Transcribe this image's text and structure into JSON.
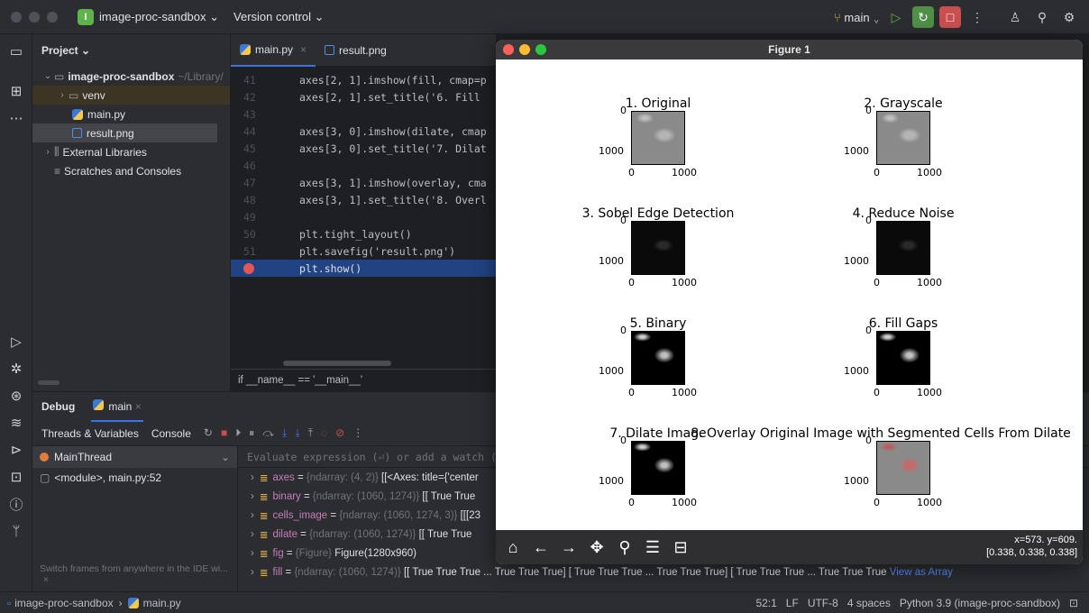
{
  "titlebar": {
    "project_letter": "I",
    "project_name": "image-proc-sandbox",
    "version_control": "Version control",
    "branch": "main"
  },
  "project_panel": {
    "title": "Project",
    "root_name": "image-proc-sandbox",
    "root_path": "~/Library/",
    "items": [
      {
        "label": "venv"
      },
      {
        "label": "main.py"
      },
      {
        "label": "result.png"
      },
      {
        "label": "External Libraries"
      },
      {
        "label": "Scratches and Consoles"
      }
    ]
  },
  "editor": {
    "tabs": [
      {
        "label": "main.py"
      },
      {
        "label": "result.png"
      }
    ],
    "lines": [
      {
        "num": "41",
        "code": "axes[2, 1].imshow(fill, cmap=p"
      },
      {
        "num": "42",
        "code": "axes[2, 1].set_title('6. Fill "
      },
      {
        "num": "43",
        "code": ""
      },
      {
        "num": "44",
        "code": "axes[3, 0].imshow(dilate, cmap"
      },
      {
        "num": "45",
        "code": "axes[3, 0].set_title('7. Dilat"
      },
      {
        "num": "46",
        "code": ""
      },
      {
        "num": "47",
        "code": "axes[3, 1].imshow(overlay, cma"
      },
      {
        "num": "48",
        "code": "axes[3, 1].set_title('8. Overl"
      },
      {
        "num": "49",
        "code": ""
      },
      {
        "num": "50",
        "code": "plt.tight_layout()"
      },
      {
        "num": "51",
        "code": "plt.savefig('result.png')"
      },
      {
        "num": "52",
        "code": "plt.show()"
      }
    ],
    "breadcrumb": "if __name__ == '__main__'"
  },
  "debug": {
    "title": "Debug",
    "session": "main",
    "tabs": [
      "Threads & Variables",
      "Console"
    ],
    "thread": "MainThread",
    "frame": "<module>, main.py:52",
    "eval_placeholder": "Evaluate expression (⏎) or add a watch (⇧",
    "hint": "Switch frames from anywhere in the IDE wi...",
    "variables": [
      {
        "name": "axes",
        "type": "{ndarray: (4, 2)}",
        "value": "[[<Axes: title={'center"
      },
      {
        "name": "binary",
        "type": "{ndarray: (1060, 1274)}",
        "value": "[[ True  True"
      },
      {
        "name": "cells_image",
        "type": "{ndarray: (1060, 1274, 3)}",
        "value": "[[[23"
      },
      {
        "name": "dilate",
        "type": "{ndarray: (1060, 1274)}",
        "value": "[[ True  True"
      },
      {
        "name": "fig",
        "type": "{Figure}",
        "value": "Figure(1280x960)"
      },
      {
        "name": "fill",
        "type": "{ndarray: (1060, 1274)}",
        "value": "[[ True  True  True ...  True  True  True] [ True  True  True ...  True  True  True] [ True  True  True ...  True  True  True"
      }
    ],
    "view_as_array": "View as Array"
  },
  "status": {
    "project": "image-proc-sandbox",
    "file": "main.py",
    "position": "52:1",
    "line_sep": "LF",
    "encoding": "UTF-8",
    "indent": "4 spaces",
    "interpreter": "Python 3.9 (image-proc-sandbox)"
  },
  "figure": {
    "window_title": "Figure 1",
    "subplots": [
      {
        "title": "1. Original",
        "style": "gray"
      },
      {
        "title": "2. Grayscale",
        "style": "gray"
      },
      {
        "title": "3. Sobel Edge Detection",
        "style": "black"
      },
      {
        "title": "4. Reduce Noise",
        "style": "black"
      },
      {
        "title": "5. Binary",
        "style": "binary"
      },
      {
        "title": "6. Fill Gaps",
        "style": "binary"
      },
      {
        "title": "7. Dilate Image",
        "style": "binary"
      },
      {
        "title": "8. Overlay Original Image with Segmented Cells From Dilate",
        "style": "overlay"
      }
    ],
    "tick_y0": "0",
    "tick_y1": "1000",
    "tick_x0": "0",
    "tick_x1": "1000",
    "coords_line1": "x=573. y=609.",
    "coords_line2": "[0.338, 0.338, 0.338]"
  }
}
